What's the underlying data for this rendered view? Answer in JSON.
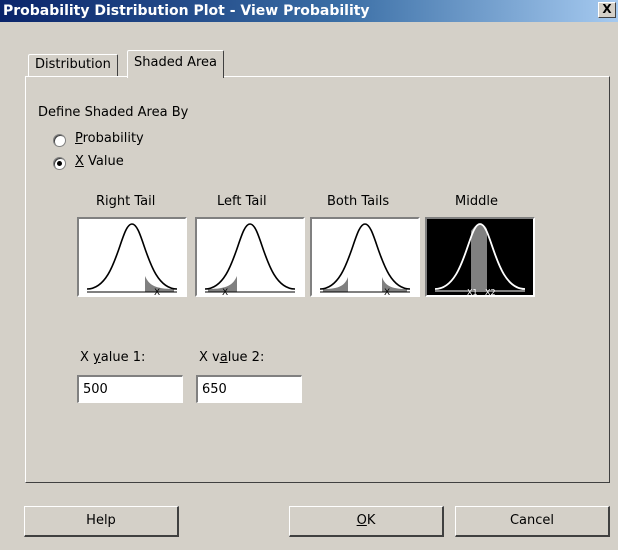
{
  "window": {
    "title": "Probability Distribution Plot - View Probability",
    "close_glyph": "X"
  },
  "tabs": [
    {
      "label": "Distribution",
      "active": false
    },
    {
      "label": "Shaded Area",
      "active": true
    }
  ],
  "shaded_area": {
    "group_label": "Define Shaded Area By",
    "options": [
      {
        "label_mnemonic": "P",
        "label_rest": "robability",
        "selected": false
      },
      {
        "label_mnemonic": "X",
        "label_rest": " Value",
        "selected": true
      }
    ],
    "tail_types": [
      {
        "label": "Right Tail",
        "selected": false,
        "marker": "X"
      },
      {
        "label": "Left Tail",
        "selected": false,
        "marker": "X"
      },
      {
        "label": "Both Tails",
        "selected": false,
        "marker": "X"
      },
      {
        "label": "Middle",
        "selected": true,
        "marker1": "X1",
        "marker2": "X2"
      }
    ],
    "x_value_1": {
      "label_pre": "X ",
      "label_mnemonic": "y",
      "label_post": "alue 1:",
      "value": "500"
    },
    "x_value_2": {
      "label_pre": "X v",
      "label_mnemonic": "a",
      "label_post": "lue 2:",
      "value": "650"
    }
  },
  "buttons": {
    "help": "Help",
    "ok_mnemonic": "O",
    "ok_rest": "K",
    "cancel": "Cancel"
  },
  "colors": {
    "title_bar": "#0a246a",
    "dialog_bg": "#d4d0c8",
    "shade": "#808080"
  }
}
